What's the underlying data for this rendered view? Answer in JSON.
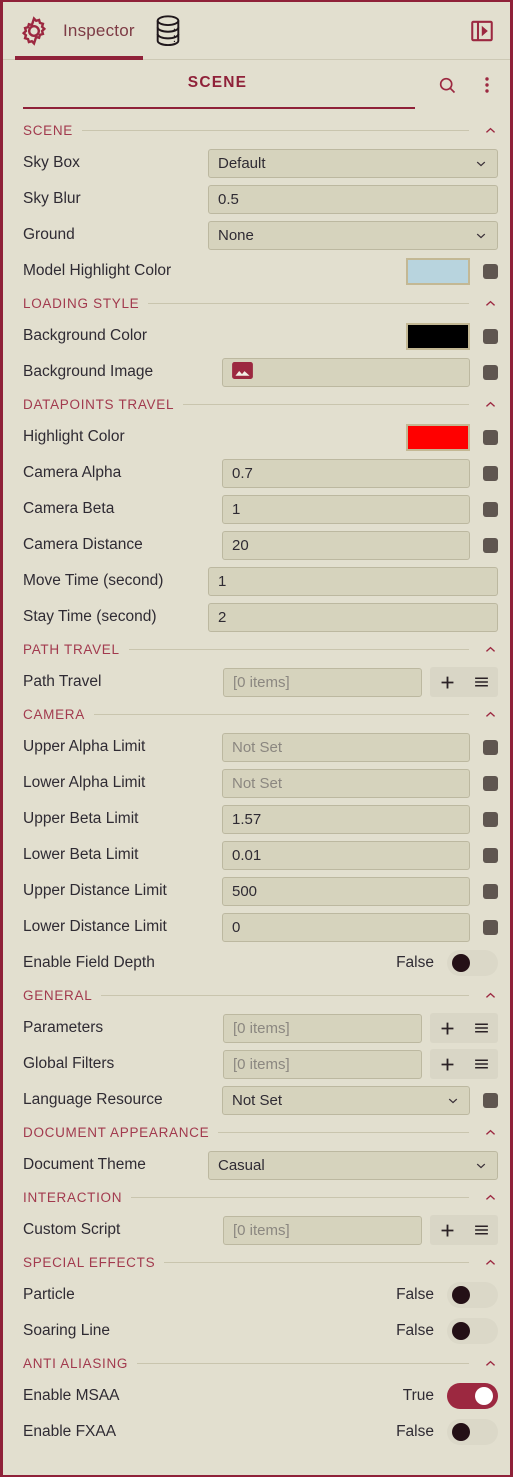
{
  "tabs": [
    {
      "label": "Inspector",
      "icon": "gear-icon",
      "active": true
    },
    {
      "label": "",
      "icon": "database-icon",
      "active": false
    }
  ],
  "header": {
    "panel_toggle_icon": "panel-expand-icon",
    "title": "SCENE",
    "search_icon": "search-icon",
    "more_icon": "more-vertical-icon"
  },
  "colors": {
    "accent": "#8f2139",
    "section_title": "#a23a4e",
    "panel_bg": "#e2dfcf",
    "field_bg": "#d6d3bd",
    "toggle_on": "#9c2840",
    "model_highlight": "#b8d4de",
    "loading_background": "#000000",
    "datapoints_highlight": "#ff0000"
  },
  "sections": [
    {
      "title": "SCENE",
      "collapse_icon": "chevron-up-icon",
      "rows": [
        {
          "label": "Sky Box",
          "type": "select",
          "value": "Default"
        },
        {
          "label": "Sky Blur",
          "type": "input",
          "value": "0.5"
        },
        {
          "label": "Ground",
          "type": "select",
          "value": "None"
        },
        {
          "label": "Model Highlight Color",
          "type": "color",
          "value": "#b8d4de"
        }
      ]
    },
    {
      "title": "LOADING STYLE",
      "collapse_icon": "chevron-up-icon",
      "rows": [
        {
          "label": "Background Color",
          "type": "color",
          "value": "#000000"
        },
        {
          "label": "Background Image",
          "type": "image",
          "value": ""
        }
      ]
    },
    {
      "title": "DATAPOINTS TRAVEL",
      "collapse_icon": "chevron-up-icon",
      "rows": [
        {
          "label": "Highlight Color",
          "type": "color",
          "value": "#ff0000"
        },
        {
          "label": "Camera Alpha",
          "type": "input-btn",
          "value": "0.7"
        },
        {
          "label": "Camera Beta",
          "type": "input-btn",
          "value": "1"
        },
        {
          "label": "Camera Distance",
          "type": "input-btn",
          "value": "20"
        },
        {
          "label": "Move Time (second)",
          "type": "input",
          "value": "1"
        },
        {
          "label": "Stay Time (second)",
          "type": "input",
          "value": "2"
        }
      ]
    },
    {
      "title": "PATH TRAVEL",
      "collapse_icon": "chevron-up-icon",
      "rows": [
        {
          "label": "Path Travel",
          "type": "list",
          "placeholder": "[0 items]",
          "add_icon": "plus-icon",
          "menu_icon": "list-menu-icon"
        }
      ]
    },
    {
      "title": "CAMERA",
      "collapse_icon": "chevron-up-icon",
      "rows": [
        {
          "label": "Upper Alpha Limit",
          "type": "input-btn",
          "value": "",
          "placeholder": "Not Set"
        },
        {
          "label": "Lower Alpha Limit",
          "type": "input-btn",
          "value": "",
          "placeholder": "Not Set"
        },
        {
          "label": "Upper Beta Limit",
          "type": "input-btn",
          "value": "1.57"
        },
        {
          "label": "Lower Beta Limit",
          "type": "input-btn",
          "value": "0.01"
        },
        {
          "label": "Upper Distance Limit",
          "type": "input-btn",
          "value": "500"
        },
        {
          "label": "Lower Distance Limit",
          "type": "input-btn",
          "value": "0"
        },
        {
          "label": "Enable Field Depth",
          "type": "bool",
          "value": "False",
          "on": false
        }
      ]
    },
    {
      "title": "GENERAL",
      "collapse_icon": "chevron-up-icon",
      "rows": [
        {
          "label": "Parameters",
          "type": "list",
          "placeholder": "[0 items]",
          "add_icon": "plus-icon",
          "menu_icon": "list-menu-icon"
        },
        {
          "label": "Global Filters",
          "type": "list",
          "placeholder": "[0 items]",
          "add_icon": "plus-icon",
          "menu_icon": "list-menu-icon"
        },
        {
          "label": "Language Resource",
          "type": "select-btn",
          "value": "Not Set"
        }
      ]
    },
    {
      "title": "DOCUMENT APPEARANCE",
      "collapse_icon": "chevron-up-icon",
      "rows": [
        {
          "label": "Document Theme",
          "type": "select",
          "value": "Casual"
        }
      ]
    },
    {
      "title": "INTERACTION",
      "collapse_icon": "chevron-up-icon",
      "rows": [
        {
          "label": "Custom Script",
          "type": "list",
          "placeholder": "[0 items]",
          "add_icon": "plus-icon",
          "menu_icon": "list-menu-icon"
        }
      ]
    },
    {
      "title": "SPECIAL EFFECTS",
      "collapse_icon": "chevron-up-icon",
      "rows": [
        {
          "label": "Particle",
          "type": "bool",
          "value": "False",
          "on": false
        },
        {
          "label": "Soaring Line",
          "type": "bool",
          "value": "False",
          "on": false
        }
      ]
    },
    {
      "title": "ANTI ALIASING",
      "collapse_icon": "chevron-up-icon",
      "rows": [
        {
          "label": "Enable MSAA",
          "type": "bool",
          "value": "True",
          "on": true
        },
        {
          "label": "Enable FXAA",
          "type": "bool",
          "value": "False",
          "on": false
        }
      ]
    }
  ]
}
